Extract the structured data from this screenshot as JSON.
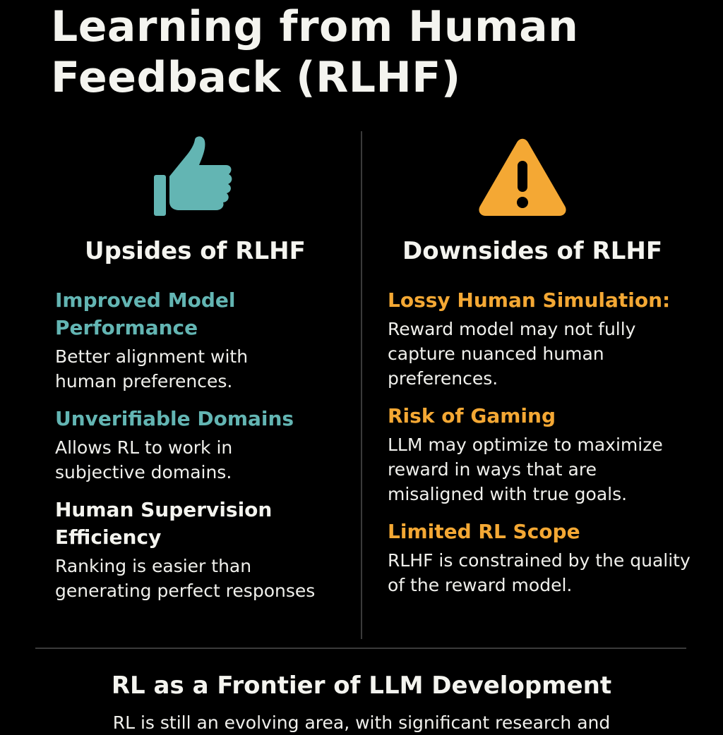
{
  "title": "Learning from Human Feedback (RLHF)",
  "colors": {
    "background": "#000000",
    "upside_accent": "#63b5b3",
    "downside_accent": "#f4a834",
    "text": "#f4f4ef",
    "divider": "#3a3a3a"
  },
  "upsides": {
    "icon": "thumbs-up-icon",
    "heading": "Upsides of RLHF",
    "items": [
      {
        "title": "Improved Model Performance",
        "description": "Better alignment with human preferences."
      },
      {
        "title": "Unverifiable Domains",
        "description": "Allows RL to work in subjective domains."
      },
      {
        "title": "Human Supervision Efficiency",
        "description": "Ranking is easier than generating perfect responses"
      }
    ]
  },
  "downsides": {
    "icon": "warning-icon",
    "heading": "Downsides of RLHF",
    "items": [
      {
        "title": "Lossy Human Simulation:",
        "description": "Reward model may not fully capture nuanced human preferences."
      },
      {
        "title": "Risk of Gaming",
        "description": "LLM may optimize to maximize reward in ways that are misaligned with true goals."
      },
      {
        "title": "Limited RL Scope",
        "description": "RLHF is constrained by the quality of the reward model."
      }
    ]
  },
  "footer": {
    "heading": "RL as a Frontier of LLM Development",
    "text": "RL is still an evolving area, with significant research and"
  }
}
